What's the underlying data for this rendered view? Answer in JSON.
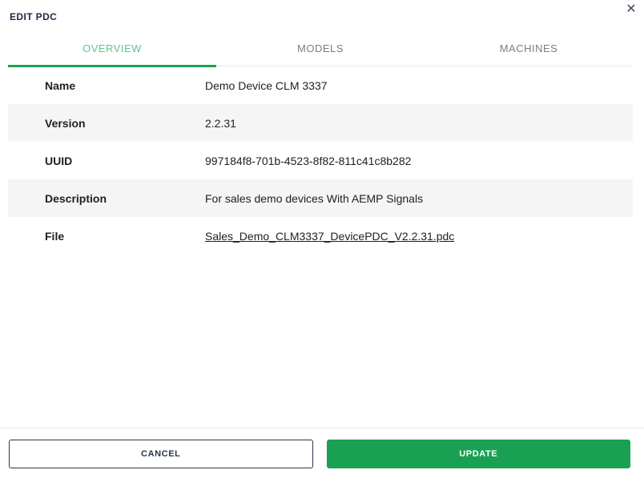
{
  "dialog": {
    "title": "EDIT PDC",
    "close_glyph": "✕"
  },
  "tabs": [
    {
      "label": "OVERVIEW",
      "active": true
    },
    {
      "label": "MODELS",
      "active": false
    },
    {
      "label": "MACHINES",
      "active": false
    }
  ],
  "fields": [
    {
      "label": "Name",
      "value": "Demo Device CLM 3337",
      "type": "text"
    },
    {
      "label": "Version",
      "value": "2.2.31",
      "type": "text"
    },
    {
      "label": "UUID",
      "value": "997184f8-701b-4523-8f82-811c41c8b282",
      "type": "text"
    },
    {
      "label": "Description",
      "value": "For sales demo devices With AEMP Signals",
      "type": "text"
    },
    {
      "label": "File",
      "value": "Sales_Demo_CLM3337_DevicePDC_V2.2.31.pdc",
      "type": "link"
    }
  ],
  "footer": {
    "cancel_label": "CANCEL",
    "update_label": "UPDATE"
  },
  "colors": {
    "accent_green": "#1aa053",
    "active_tab_text": "#5cc68c",
    "inactive_tab_text": "#757d88",
    "row_stripe": "#f5f5f5",
    "dark_navy": "#29364d"
  }
}
